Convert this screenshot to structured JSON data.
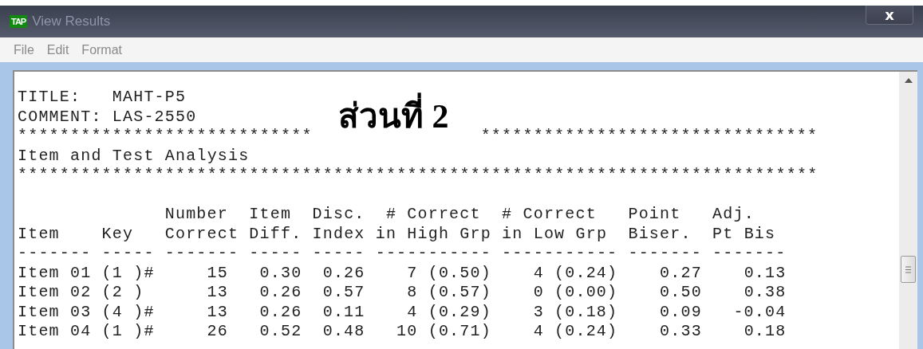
{
  "window": {
    "app_badge": "TAP",
    "title": "View Results",
    "close": "x"
  },
  "menu": [
    {
      "label": "File"
    },
    {
      "label": "Edit"
    },
    {
      "label": "Format"
    }
  ],
  "report": {
    "title_label": "TITLE:",
    "title": "MAHT-P5",
    "comment_label": "COMMENT:",
    "comment": "LAS-2550",
    "rule_1": [
      "****************************",
      "********************************"
    ],
    "overlay": "ส่วนที่ 2",
    "heading": "Item and Test Analysis",
    "rule_2": "****************************************************************************",
    "columns": [
      {
        "bottom": "Item",
        "rule": "-------"
      },
      {
        "bottom": "Key",
        "rule": "-----"
      },
      {
        "top": "Number",
        "bottom": "Correct",
        "rule": "-------"
      },
      {
        "top": "Item",
        "bottom": "Diff.",
        "rule": "-----"
      },
      {
        "top": "Disc.",
        "bottom": "Index",
        "rule": "-----"
      },
      {
        "top": "# Correct",
        "bottom": "in High Grp",
        "rule": "-----------"
      },
      {
        "top": "# Correct",
        "bottom": "in Low Grp",
        "rule": "-----------"
      },
      {
        "top": "Point",
        "bottom": "Biser.",
        "rule": "-------"
      },
      {
        "top": "Adj.",
        "bottom": "Pt Bis",
        "rule": "-------"
      }
    ],
    "rows": [
      [
        "Item 01",
        "(1 )#",
        "15",
        "0.30",
        "0.26",
        "7 (0.50)",
        "4 (0.24)",
        "0.27",
        "0.13"
      ],
      [
        "Item 02",
        "(2 )",
        "13",
        "0.26",
        "0.57",
        "8 (0.57)",
        "0 (0.00)",
        "0.50",
        "0.38"
      ],
      [
        "Item 03",
        "(4 )#",
        "13",
        "0.26",
        "0.11",
        "4 (0.29)",
        "3 (0.18)",
        "0.09",
        "-0.04"
      ],
      [
        "Item 04",
        "(1 )#",
        "26",
        "0.52",
        "0.48",
        "10 (0.71)",
        "4 (0.24)",
        "0.33",
        "0.18"
      ]
    ]
  }
}
